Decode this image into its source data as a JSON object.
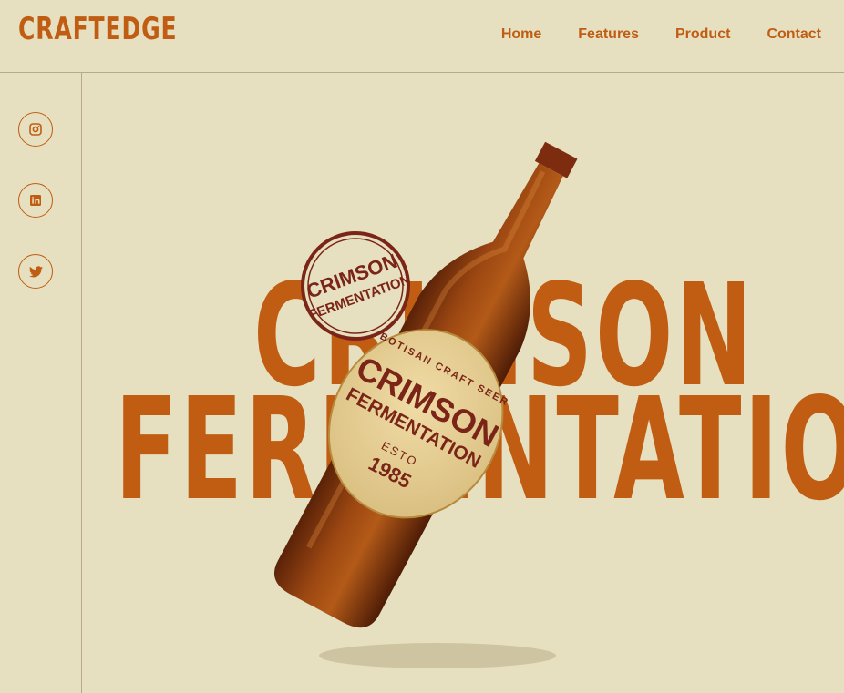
{
  "brand": {
    "logo": "CRAFTEDGE"
  },
  "nav": {
    "items": [
      "Home",
      "Features",
      "Product",
      "Contact"
    ]
  },
  "social": [
    "instagram-icon",
    "linkedin-icon",
    "twitter-icon"
  ],
  "hero": {
    "line1": "CRIMSON",
    "line2": "FERMENTATION"
  },
  "stamp": {
    "line1": "CRIMSON",
    "line2": "FERMENTATION"
  },
  "label": {
    "arc": "BOTISAN CRAFT SEER",
    "name1": "CRIMSON",
    "name2": "FERMENTATION",
    "esto": "ESTO",
    "year": "1985"
  },
  "colors": {
    "background": "#e6e0c1",
    "accent": "#c05d12",
    "bottle": "#8a3d12",
    "label": "#e8d29a"
  }
}
